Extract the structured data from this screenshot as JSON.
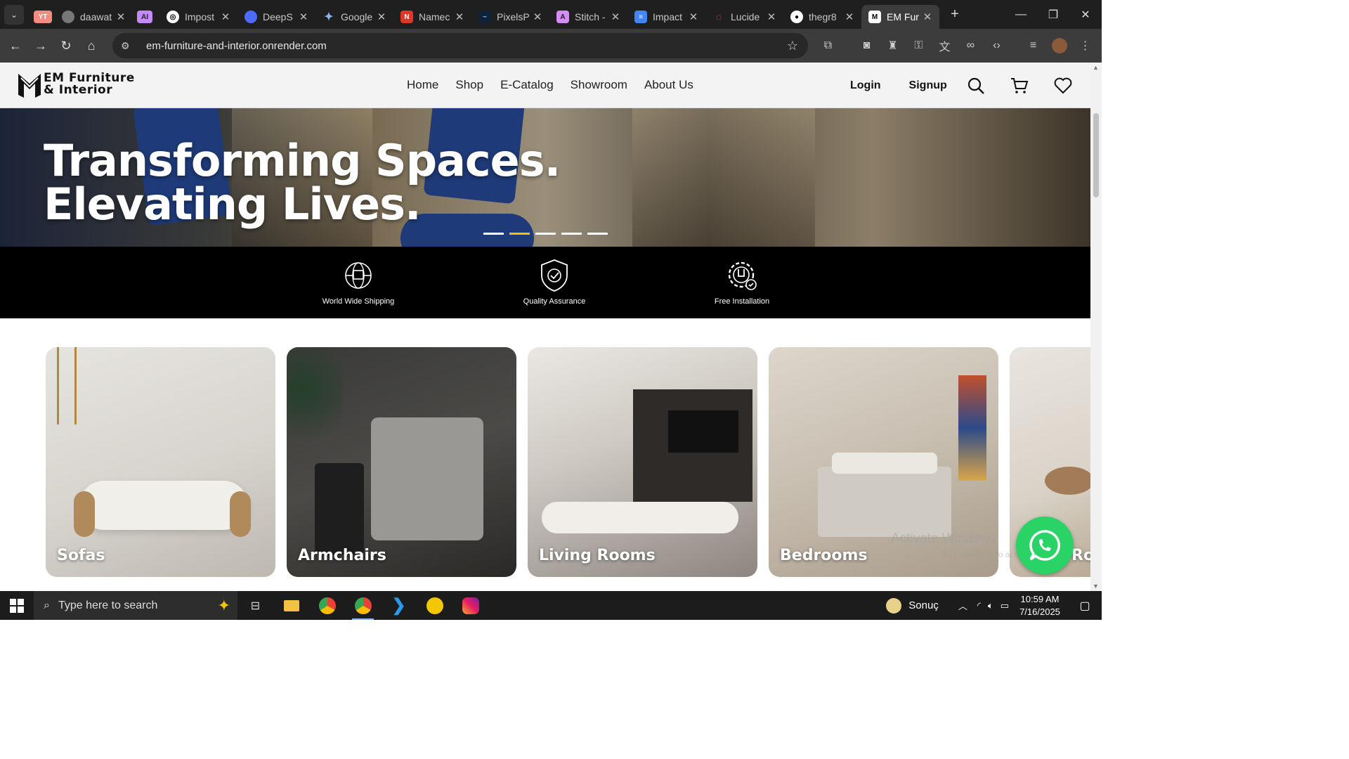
{
  "browser": {
    "tabs": [
      {
        "label": "",
        "badge": "YT",
        "badge_color": "#f28b82"
      },
      {
        "label": "daawat",
        "icon": "globe-icon"
      },
      {
        "label": "",
        "badge": "AI",
        "badge_color": "#c58af9"
      },
      {
        "label": "Impost",
        "icon": "openai-icon"
      },
      {
        "label": "DeepS",
        "icon": "deepseek-icon"
      },
      {
        "label": "Google",
        "icon": "gemini-icon"
      },
      {
        "label": "Namec",
        "icon": "namecheap-icon"
      },
      {
        "label": "PixelsP",
        "icon": "pixels-icon"
      },
      {
        "label": "Stitch -",
        "icon": "stitch-icon"
      },
      {
        "label": "Impact",
        "icon": "docs-icon"
      },
      {
        "label": "Lucide",
        "icon": "lucide-icon"
      },
      {
        "label": "thegr8",
        "icon": "github-icon"
      },
      {
        "label": "EM Fur",
        "icon": "em-logo-icon",
        "active": true
      }
    ],
    "url": "em-furniture-and-interior.onrender.com"
  },
  "site": {
    "logo_line1": "EM Furniture",
    "logo_line2": "& Interior",
    "menu": [
      "Home",
      "Shop",
      "E-Catalog",
      "Showroom",
      "About Us"
    ],
    "login": "Login",
    "signup": "Signup",
    "hero_line1": "Transforming Spaces.",
    "hero_line2": "Elevating Lives.",
    "slider_active_index": 1,
    "slider_count": 5,
    "features": [
      "World Wide Shipping",
      "Quality Assurance",
      "Free Installation"
    ],
    "categories": [
      "Sofas",
      "Armchairs",
      "Living Rooms",
      "Bedrooms",
      "Ro"
    ],
    "accent_color": "#f2c200",
    "whatsapp_color": "#29d366"
  },
  "overlay": {
    "activate_windows": "Activate Windows",
    "activate_sub": "Go to Settings to activate Windows."
  },
  "taskbar": {
    "search_placeholder": "Type here to search",
    "weather": "Sonuç",
    "time": "10:59 AM",
    "date": "7/16/2025"
  }
}
